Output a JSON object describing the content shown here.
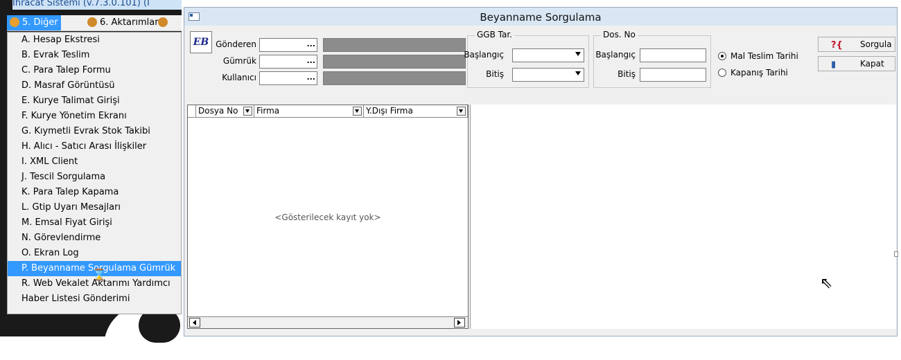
{
  "app_title": "Ihracat Sistemi (v.7.3.0.101) (I",
  "menubar": {
    "items": [
      {
        "label": "5. Diğer",
        "selected": true,
        "icon": "people-icon"
      },
      {
        "label": "6. Aktarımlar",
        "icon": "people-icon"
      },
      {
        "label": "",
        "icon": "people-icon"
      }
    ]
  },
  "dropdown": {
    "items": [
      "A. Hesap Ekstresi",
      "B. Evrak Teslim",
      "C. Para Talep Formu",
      "D. Masraf Görüntüsü",
      "E. Kurye Talimat Girişi",
      "F. Kurye Yönetim Ekranı",
      "G. Kıymetli Evrak Stok Takibi",
      "H. Alıcı - Satıcı Arası İlişkiler",
      "I. XML Client",
      "J. Tescil Sorgulama",
      "K. Para Talep Kapama",
      "L. Gtip Uyarı Mesajları",
      "M. Emsal Fiyat Girişi",
      "N. Görevlendirme",
      "O. Ekran Log",
      "P. Beyanname Sorgulama Gümrük",
      "R. Web Vekalet Aktarımı Yardımcı",
      "Haber Listesi Gönderimi"
    ],
    "selected_index": 15
  },
  "window": {
    "title": "Beyanname Sorgulama",
    "logo_text": "EB",
    "fields": {
      "gonderen_label": "Gönderen",
      "gumruk_label": "Gümrük",
      "kullanici_label": "Kullanıcı",
      "ellipsis": "..."
    },
    "ggb_group": {
      "title": "GGB Tar.",
      "start_label": "Başlangıç",
      "end_label": "Bitiş"
    },
    "dos_group": {
      "title": "Dos. No",
      "start_label": "Başlangıç",
      "end_label": "Bitiş"
    },
    "radios": [
      {
        "label": "Mal Teslim Tarihi",
        "checked": true
      },
      {
        "label": "Kapanış Tarihi",
        "checked": false
      }
    ],
    "buttons": {
      "query": "Sorgula",
      "close": "Kapat"
    },
    "grid": {
      "columns": [
        "Dosya No",
        "Firma",
        "Y.Dışı Firma"
      ],
      "empty_text": "<Gösterilecek kayıt yok>"
    }
  },
  "colors": {
    "selection": "#3399ff",
    "title_bar": "#d9e6f4",
    "menu_bg": "#f0f0f0"
  }
}
